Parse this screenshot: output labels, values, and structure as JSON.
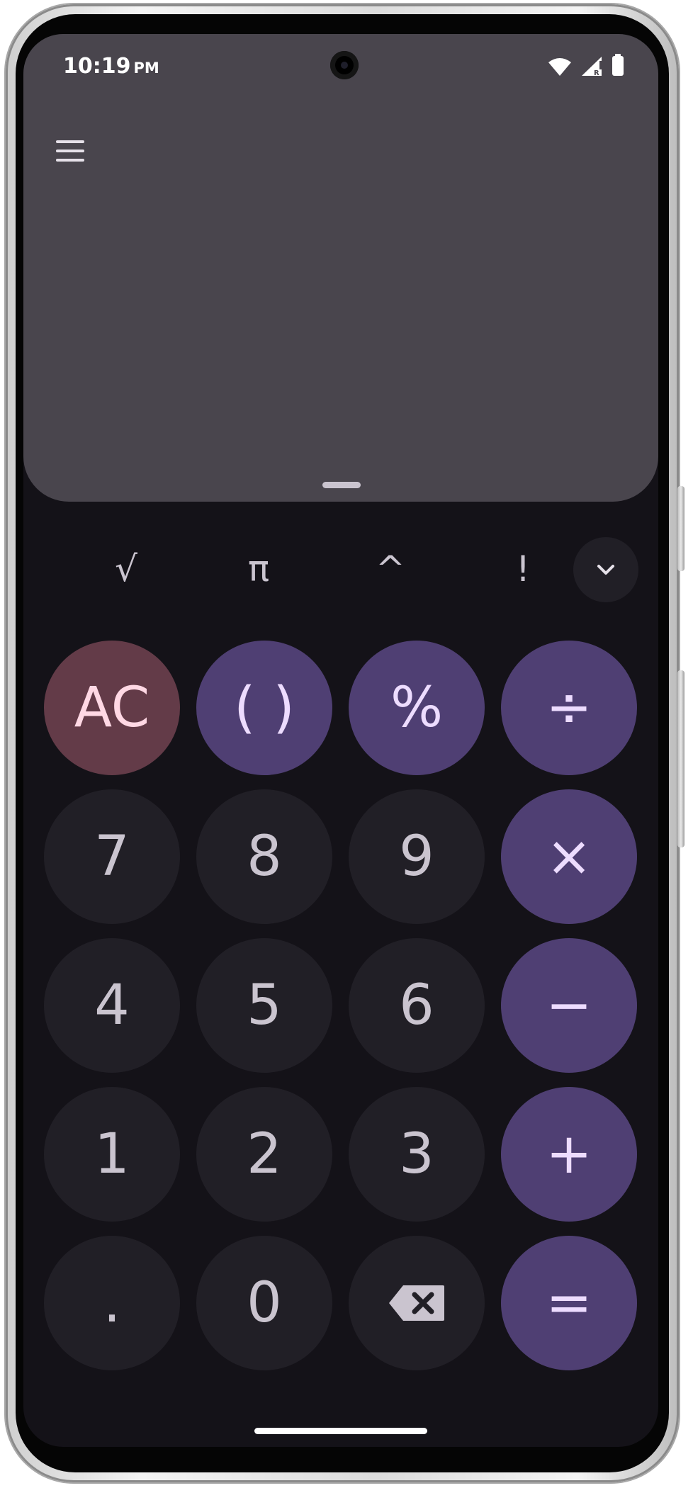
{
  "status_bar": {
    "time": "10:19",
    "ampm": "PM",
    "icons": [
      "wifi-icon",
      "signal-icon",
      "battery-icon"
    ]
  },
  "display": {
    "menu_icon": "menu-icon",
    "expression": "",
    "result": ""
  },
  "scientific_row": {
    "keys": [
      "√",
      "π",
      "^",
      "!"
    ],
    "expand_icon": "chevron-down-icon"
  },
  "keypad": {
    "rows": [
      [
        "AC",
        "( )",
        "%",
        "÷"
      ],
      [
        "7",
        "8",
        "9",
        "×"
      ],
      [
        "4",
        "5",
        "6",
        "−"
      ],
      [
        "1",
        "2",
        "3",
        "+"
      ],
      [
        ".",
        "0",
        "⌫",
        "="
      ]
    ]
  },
  "colors": {
    "background": "#141218",
    "display_panel": "#49454d",
    "number_key": "#211f26",
    "operator_key": "#4f3f73",
    "clear_key": "#633b48",
    "key_text": "#cac4cf",
    "operator_text": "#eddcff",
    "clear_text": "#ffd8e4"
  }
}
